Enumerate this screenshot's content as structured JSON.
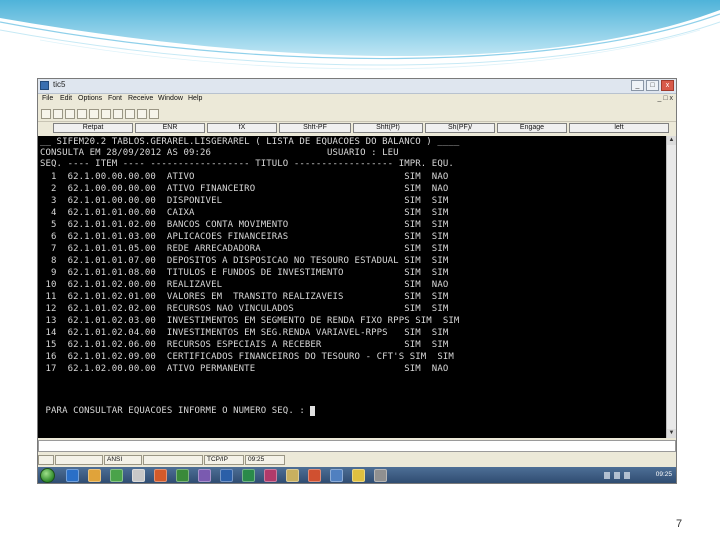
{
  "window": {
    "title": "tic5",
    "minimize_label": "_",
    "maximize_label": "□",
    "close_label": "x"
  },
  "menu": {
    "items": [
      "File",
      "Edit",
      "Options",
      "Font",
      "Receive",
      "Window",
      "Help"
    ],
    "mdi_controls": "_ □ x"
  },
  "fkeys": [
    "Retpat",
    "ENR",
    "fX",
    "Shft-PF",
    "Shft(Pf)",
    "Sh(PF)/",
    "Engage",
    "left"
  ],
  "terminal": {
    "lines": [
      "__ SIFEM20.2 TABLOS.GERAREL.LISGERAREL ( LISTA DE EQUACOES DO BALANCO ) ____",
      "CONSULTA EM 28/09/2012 AS 09:26                     USUARIO : LEU",
      "SEQ. ---- ITEM ---- ------------------ TITULO ------------------ IMPR. EQU.",
      "  1  62.1.00.00.00.00  ATIVO                                      SIM  NAO",
      "  2  62.1.00.00.00.00  ATIVO FINANCEIRO                           SIM  NAO",
      "  3  62.1.01.00.00.00  DISPONIVEL                                 SIM  SIM",
      "  4  62.1.01.01.00.00  CAIXA                                      SIM  SIM",
      "  5  62.1.01.01.02.00  BANCOS CONTA MOVIMENTO                     SIM  SIM",
      "  6  62.1.01.01.03.00  APLICACOES FINANCEIRAS                     SIM  SIM",
      "  7  62.1.01.01.05.00  REDE ARRECADADORA                          SIM  SIM",
      "  8  62.1.01.01.07.00  DEPOSITOS A DISPOSICAO NO TESOURO ESTADUAL SIM  SIM",
      "  9  62.1.01.01.08.00  TITULOS E FUNDOS DE INVESTIMENTO           SIM  SIM",
      " 10  62.1.01.02.00.00  REALIZAVEL                                 SIM  NAO",
      " 11  62.1.01.02.01.00  VALORES EM  TRANSITO REALIZAVEIS           SIM  SIM",
      " 12  62.1.01.02.02.00  RECURSOS NAO VINCULADOS                    SIM  SIM",
      " 13  62.1.01.02.03.00  INVESTIMENTOS EM SEGMENTO DE RENDA FIXO RPPS SIM  SIM",
      " 14  62.1.01.02.04.00  INVESTIMENTOS EM SEG.RENDA VARIAVEL-RPPS   SIM  SIM",
      " 15  62.1.01.02.06.00  RECURSOS ESPECIAIS A RECEBER               SIM  SIM",
      " 16  62.1.01.02.09.00  CERTIFICADOS FINANCEIROS DO TESOURO - CFT'S SIM  SIM",
      " 17  62.1.02.00.00.00  ATIVO PERMANENTE                           SIM  NAO"
    ],
    "prompt": " PARA CONSULTAR EQUACOES INFORME O NUMERO SEQ. : "
  },
  "statusbar": {
    "cells": [
      "",
      "",
      "ANSI",
      "",
      "TCP/IP",
      "09:25"
    ]
  },
  "taskbar": {
    "time": "09:25"
  },
  "page_number": "7"
}
